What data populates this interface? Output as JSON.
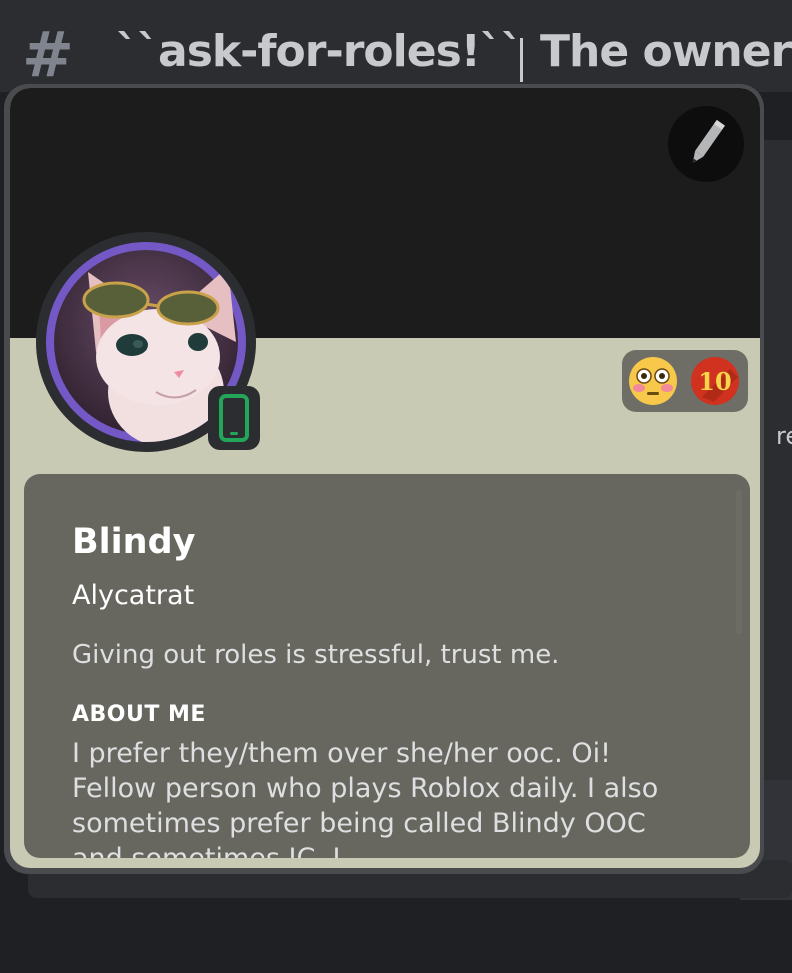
{
  "channel": {
    "name": "``ask-for-roles!``",
    "topic_partial": "The owner c"
  },
  "background": {
    "side_text": "re"
  },
  "profile": {
    "display_name": "Blindy",
    "username": "Alycatrat",
    "custom_status": "Giving out roles is stressful, trust me.",
    "about_me_heading": "ABOUT ME",
    "about_me_text": "I prefer they/them over she/her ooc. Oi! Fellow person who plays Roblox daily. I also sometimes prefer being called Blindy OOC and sometimes IC. I...",
    "status": "online-mobile",
    "badges": [
      {
        "name": "flushed-face",
        "glyph": "😳"
      },
      {
        "name": "ten-points",
        "label": "10"
      }
    ]
  },
  "colors": {
    "banner": "#1c1c1c",
    "theme_primary": "#c9cab4",
    "info_panel": "#676760",
    "avatar_ring": "#7358c6",
    "status_online": "#23a55a"
  },
  "icons": {
    "edit": "pencil-icon",
    "channel": "hash-icon",
    "status": "mobile-phone-icon"
  }
}
